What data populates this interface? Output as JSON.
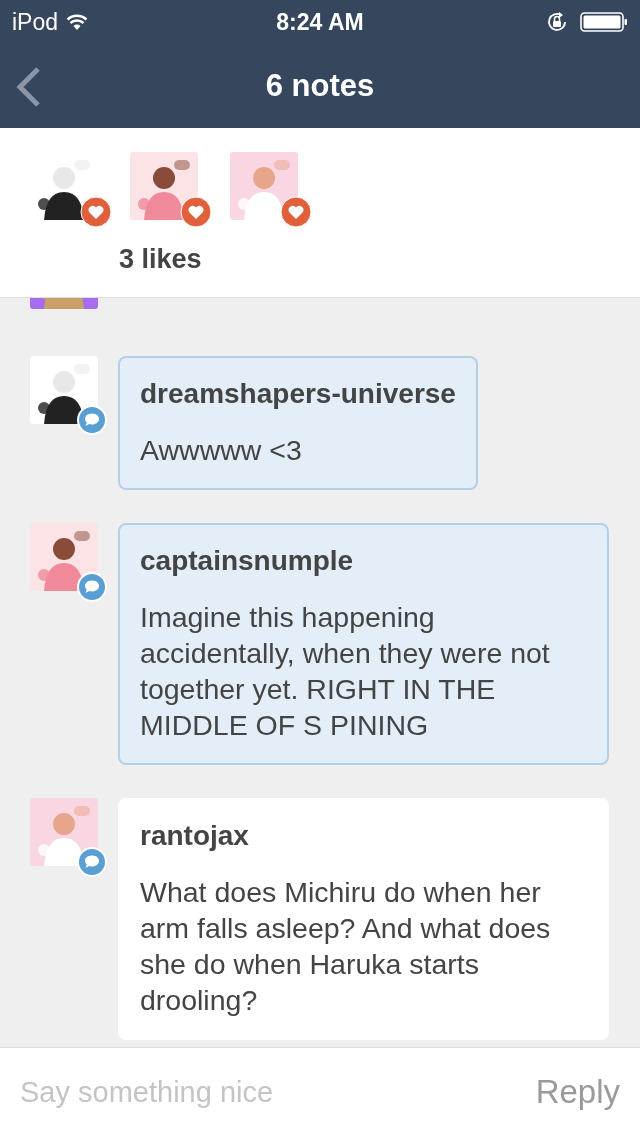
{
  "status_bar": {
    "carrier": "iPod",
    "time": "8:24 AM"
  },
  "nav": {
    "title": "6 notes"
  },
  "likes": {
    "count": "3 likes"
  },
  "comments": [
    {
      "partial": true
    },
    {
      "username": "dreamshapers-universe",
      "text": "Awwwww <3",
      "highlighted": true
    },
    {
      "username": "captainsnumple",
      "text": "Imagine this happening accidentally, when they were not together yet. RIGHT IN THE MIDDLE OF S PINING",
      "highlighted": true
    },
    {
      "username": "rantojax",
      "text": "What does Michiru do when her arm falls asleep? And what does she do when Haruka starts drooling?",
      "highlighted": false
    }
  ],
  "reply_bar": {
    "placeholder": "Say something nice",
    "button": "Reply"
  }
}
